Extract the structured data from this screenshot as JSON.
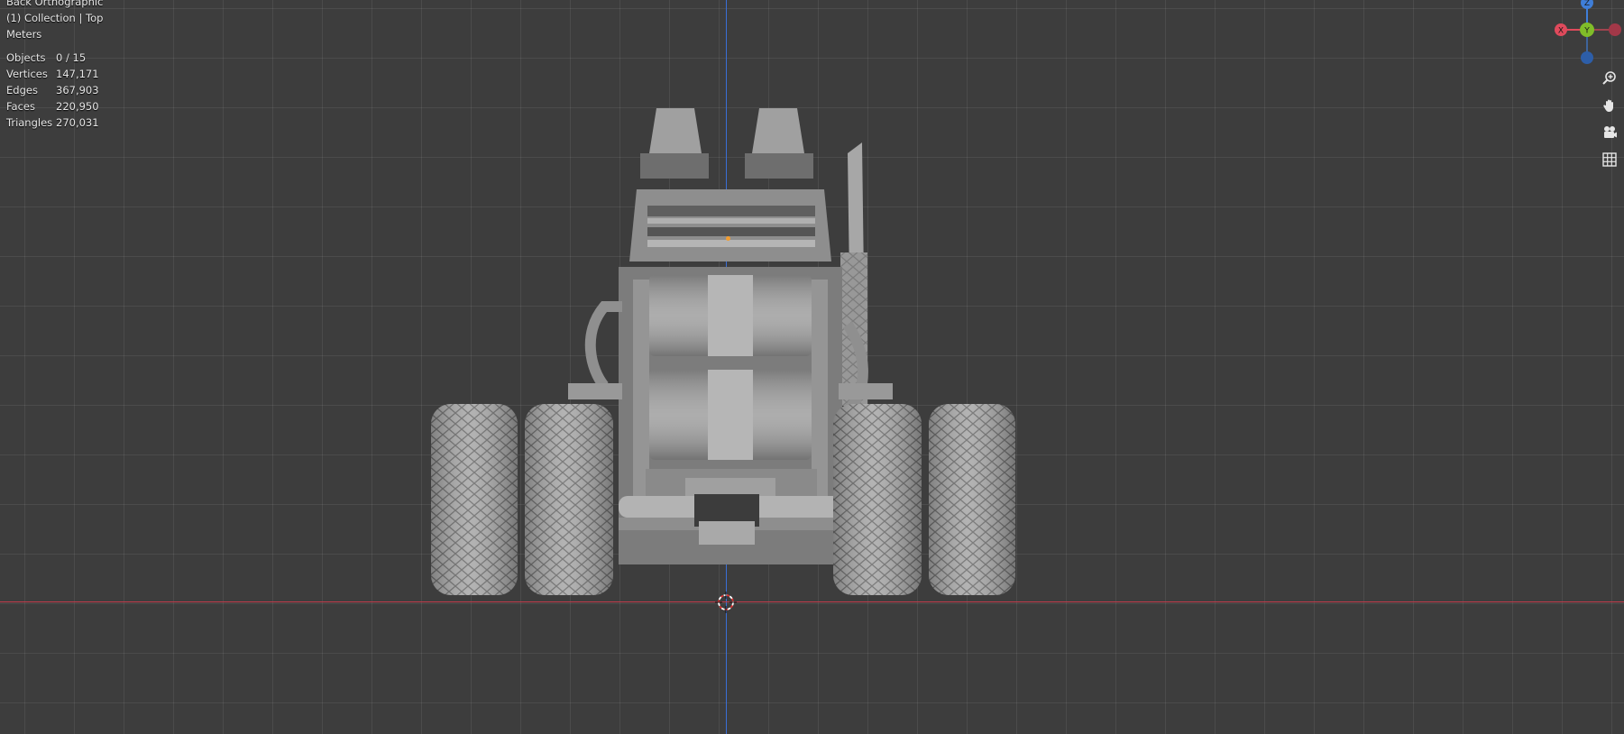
{
  "viewport": {
    "view_name": "Back Orthographic",
    "collection_info": "(1) Collection | Top",
    "units": "Meters"
  },
  "stats": [
    {
      "label": "Objects",
      "value": "0 / 15"
    },
    {
      "label": "Vertices",
      "value": "147,171"
    },
    {
      "label": "Edges",
      "value": "367,903"
    },
    {
      "label": "Faces",
      "value": "220,950"
    },
    {
      "label": "Triangles",
      "value": "270,031"
    }
  ],
  "gizmo": {
    "z_label": "Z",
    "y_label": "Y",
    "x_label": "X",
    "colors": {
      "x": "#e04a5c",
      "y": "#80bd29",
      "z": "#3f7ed8"
    }
  },
  "tools": {
    "zoom": "zoom-icon",
    "pan": "hand-icon",
    "camera": "camera-icon",
    "grid": "grid-icon"
  },
  "colors": {
    "background": "#3d3d3d",
    "axis_x": "#c23c4b",
    "axis_z": "#3a6fd6",
    "model": "#9a9a9a"
  }
}
